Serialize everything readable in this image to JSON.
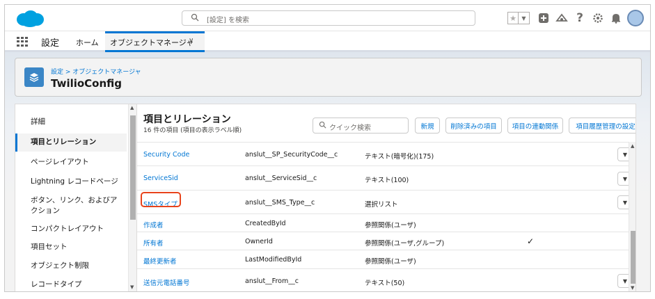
{
  "header": {
    "search_placeholder": "[設定] を検索",
    "icons": [
      "favorites-star-icon",
      "favorites-dropdown-icon",
      "global-actions-add-icon",
      "trailhead-icon",
      "help-icon",
      "setup-gear-icon",
      "notifications-bell-icon",
      "user-avatar"
    ]
  },
  "nav": {
    "app_name": "設定",
    "home": "ホーム",
    "active_tab": "オブジェクトマネージャ"
  },
  "object": {
    "breadcrumb": "設定 > オブジェクトマネージャ",
    "title": "TwilioConfig"
  },
  "sidebar": {
    "items": [
      {
        "label": "詳細"
      },
      {
        "label": "項目とリレーション"
      },
      {
        "label": "ページレイアウト"
      },
      {
        "label": "Lightning レコードページ"
      },
      {
        "label": "ボタン、リンク、およびア"
      },
      {
        "label": "クション"
      },
      {
        "label": "コンパクトレイアウト"
      },
      {
        "label": "項目セット"
      },
      {
        "label": "オブジェクト制限"
      },
      {
        "label": "レコードタイプ"
      }
    ]
  },
  "main": {
    "title": "項目とリレーション",
    "subtitle": "16 件の項目 (項目の表示ラベル順)",
    "quick_find_placeholder": "クイック検索",
    "buttons": {
      "new": "新規",
      "deleted_fields": "削除済みの項目",
      "field_dependencies": "項目の連動関係",
      "history_tracking": "項目履歴管理の設定"
    },
    "rows": [
      {
        "label": "Security Code",
        "api_name": "anslut__SP_SecurityCode__c",
        "type": "テキスト(暗号化)(175)",
        "indexed": "",
        "has_menu": true
      },
      {
        "label": "ServiceSid",
        "api_name": "anslut__ServiceSid__c",
        "type": "テキスト(100)",
        "indexed": "",
        "has_menu": true
      },
      {
        "label": "SMSタイプ",
        "api_name": "anslut__SMS_Type__c",
        "type": "選択リスト",
        "indexed": "",
        "has_menu": true
      },
      {
        "label": "作成者",
        "api_name": "CreatedById",
        "type": "参照関係(ユーザ)",
        "indexed": "",
        "has_menu": false
      },
      {
        "label": "所有者",
        "api_name": "OwnerId",
        "type": "参照関係(ユーザ,グループ)",
        "indexed": "✓",
        "has_menu": false
      },
      {
        "label": "最終更新者",
        "api_name": "LastModifiedById",
        "type": "参照関係(ユーザ)",
        "indexed": "",
        "has_menu": false
      },
      {
        "label": "送信元電話番号",
        "api_name": "anslut__From__c",
        "type": "テキスト(50)",
        "indexed": "",
        "has_menu": true
      }
    ]
  },
  "colors": {
    "brand_blue": "#0176d3",
    "highlight_red": "#e8431b",
    "object_icon": "#3b86c6"
  }
}
